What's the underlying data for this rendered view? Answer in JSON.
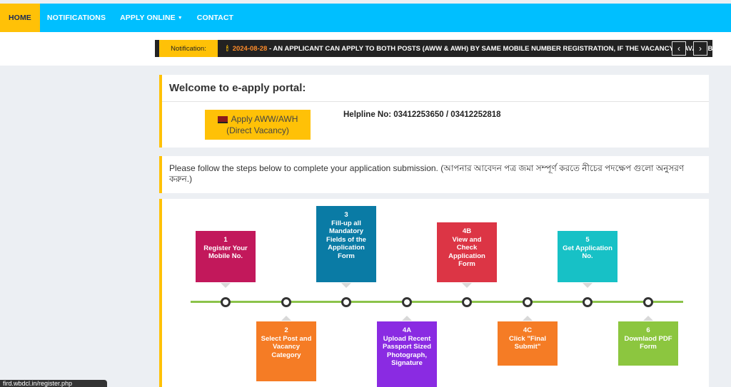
{
  "nav": {
    "home": "HOME",
    "notifications": "NOTIFICATIONS",
    "apply_online": "APPLY ONLINE",
    "contact": "CONTACT"
  },
  "ticker": {
    "label": "Notification:",
    "date": "2024-08-28",
    "message": " - AN APPLICANT CAN APPLY TO BOTH POSTS (AWW & AWH) BY SAME MOBILE NUMBER REGISTRATION, IF THE VACANCY IS AVAILABLE"
  },
  "welcome": {
    "title": "Welcome to e-apply portal:",
    "apply_line1": "Apply AWW/AWH",
    "apply_line2": "(Direct Vacancy)",
    "helpline": "Helpline No: 03412253650 / 03412252818"
  },
  "instructions": "Please follow the steps below to complete your application submission. (আপনার আবেদন পত্র জমা সম্পূর্ণ করতে নীচের পদক্ষেপ গুলো অনুসরণ করুন.)",
  "steps": [
    {
      "num": "1",
      "text": "Register Your Mobile No.",
      "color": "#c2185b"
    },
    {
      "num": "2",
      "text": "Select Post and Vacancy Category",
      "color": "#f57c25"
    },
    {
      "num": "3",
      "text": "Fill-up all Mandatory Fields of the Application Form",
      "color": "#0a7ba5"
    },
    {
      "num": "4A",
      "text": "Upload Recent Passport Sized Photograph, Signature",
      "color": "#8a2be2"
    },
    {
      "num": "4B",
      "text": "View and Check Application Form",
      "color": "#dc3545"
    },
    {
      "num": "4C",
      "text": "Click \"Final Submit\"",
      "color": "#f57c25"
    },
    {
      "num": "5",
      "text": "Get Application No.",
      "color": "#17c1c6"
    },
    {
      "num": "6",
      "text": "Downlaod PDF Form",
      "color": "#8cc63f"
    }
  ],
  "status_url": "fird.wbdcl.in/register.php"
}
